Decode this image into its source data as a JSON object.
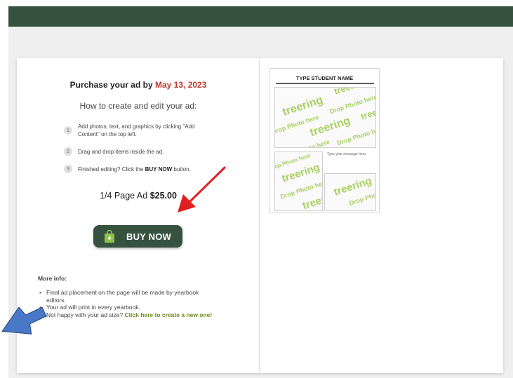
{
  "purchase": {
    "prefix": "Purchase your ad by",
    "date": "May 13, 2023"
  },
  "howto": "How to create and edit your ad:",
  "steps": [
    {
      "num": "1",
      "line1": "Add photos, text, and graphics by clicking \"Add",
      "line2": "Content\" on the top left."
    },
    {
      "num": "2",
      "text": "Drag and drop items inside the ad."
    },
    {
      "num": "3",
      "pre": "Finished editing? Click the",
      "bold": "BUY NOW",
      "post": "button."
    }
  ],
  "price": {
    "label": "1/4 Page Ad",
    "amount": "$25.00"
  },
  "buy_button": {
    "label": "BUY NOW",
    "icon": "shopping-bag-download-icon"
  },
  "more_info": {
    "heading": "More info:",
    "items": [
      {
        "line1": "Final ad placement on the page will be made by yearbook",
        "line2": "editors."
      },
      {
        "text": "Your ad will print in every yearbook."
      },
      {
        "text": "Not happy with your ad size?",
        "link": "Click here to create a new one!"
      }
    ]
  },
  "preview": {
    "title": "TYPE STUDENT NAME",
    "message_placeholder": "Type your message here.",
    "watermark_brand": "treering",
    "watermark_hint": "Drop Photo here"
  },
  "colors": {
    "header": "#37513f",
    "date": "#c0392b",
    "link": "#6a8a1f",
    "watermark": "#a9cf63"
  }
}
